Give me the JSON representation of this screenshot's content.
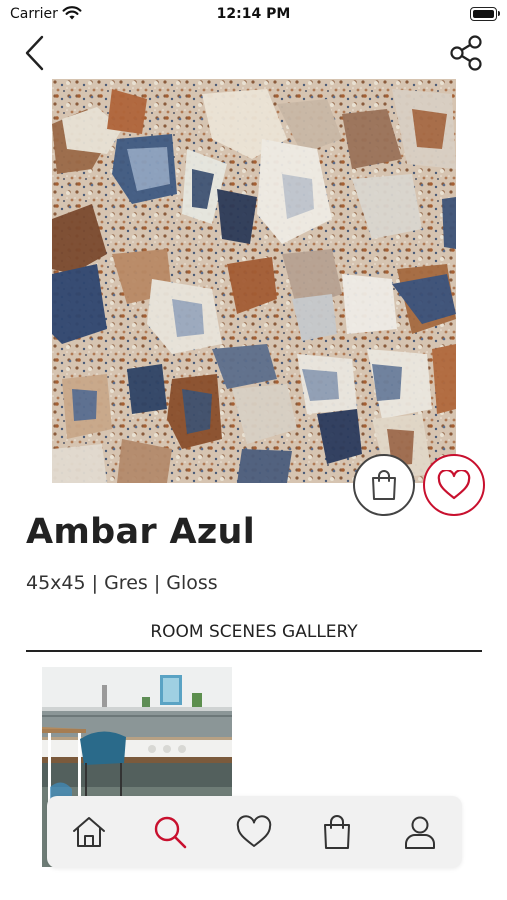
{
  "status_bar": {
    "carrier": "Carrier",
    "time": "12:14 PM",
    "wifi_icon": "wifi-icon",
    "battery_icon": "battery-icon"
  },
  "nav": {
    "back_icon": "chevron-left-icon",
    "share_icon": "share-icon"
  },
  "product": {
    "name": "Ambar Azul",
    "specs": "45x45 | Gres | Gloss",
    "image": "terrazzo-tile-image",
    "actions": {
      "cart_icon": "shopping-bag-icon",
      "favorite_icon": "heart-icon",
      "favorite_color": "#c8102e"
    }
  },
  "gallery": {
    "title": "ROOM SCENES GALLERY",
    "items": [
      {
        "image": "kitchen-room-scene-image"
      }
    ]
  },
  "tab_bar": {
    "active_color": "#c8102e",
    "inactive_color": "#333333",
    "items": [
      {
        "icon": "home-icon",
        "active": false
      },
      {
        "icon": "search-icon",
        "active": true
      },
      {
        "icon": "heart-icon",
        "active": false
      },
      {
        "icon": "shopping-bag-icon",
        "active": false
      },
      {
        "icon": "user-icon",
        "active": false
      }
    ]
  }
}
